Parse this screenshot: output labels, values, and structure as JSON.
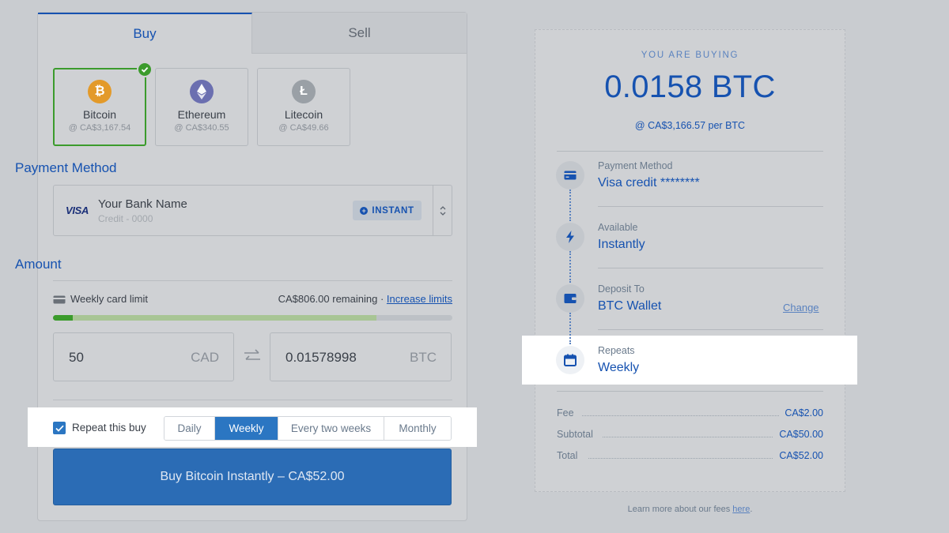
{
  "tabs": [
    {
      "label": "Buy",
      "active": true
    },
    {
      "label": "Sell",
      "active": false
    }
  ],
  "coins": [
    {
      "name": "Bitcoin",
      "price": "@ CA$3,167.54",
      "symbol": "₿",
      "color": "#e39a2a",
      "selected": true
    },
    {
      "name": "Ethereum",
      "price": "@ CA$340.55",
      "symbol": "ethereum-icon",
      "color": "#6b6fb0",
      "selected": false
    },
    {
      "name": "Litecoin",
      "price": "@ CA$49.66",
      "symbol": "Ł",
      "color": "#9aa0a6",
      "selected": false
    }
  ],
  "payment": {
    "title": "Payment Method",
    "card_brand": "VISA",
    "bank_name": "Your Bank Name",
    "bank_sub": "Credit - 0000",
    "badge": "INSTANT"
  },
  "amount": {
    "title": "Amount",
    "limit_label": "Weekly card limit",
    "remaining": "CA$806.00 remaining",
    "separator": "·",
    "increase_link": "Increase limits",
    "progress_used_fraction": 0.05,
    "progress_filled_fraction": 0.81,
    "fiat_value": "50",
    "fiat_unit": "CAD",
    "crypto_value": "0.01578998",
    "crypto_unit": "BTC"
  },
  "repeat": {
    "label": "Repeat this buy",
    "checked": true,
    "options": [
      "Daily",
      "Weekly",
      "Every two weeks",
      "Monthly"
    ],
    "selected": "Weekly"
  },
  "buy_button": "Buy Bitcoin Instantly – CA$52.00",
  "receipt": {
    "heading": "YOU ARE BUYING",
    "amount": "0.0158 BTC",
    "rate": "@ CA$3,166.57 per BTC",
    "steps": [
      {
        "label": "Payment Method",
        "value": "Visa credit ********",
        "icon": "card-icon"
      },
      {
        "label": "Available",
        "value": "Instantly",
        "icon": "lightning-icon"
      },
      {
        "label": "Deposit To",
        "value": "BTC Wallet",
        "icon": "wallet-icon",
        "action": "Change"
      },
      {
        "label": "Repeats",
        "value": "Weekly",
        "icon": "calendar-icon"
      }
    ],
    "fees": [
      {
        "label": "Fee",
        "value": "CA$2.00"
      },
      {
        "label": "Subtotal",
        "value": "CA$50.00"
      },
      {
        "label": "Total",
        "value": "CA$52.00"
      }
    ],
    "learn_more_prefix": "Learn more about our fees ",
    "learn_more_link": "here",
    "learn_more_suffix": "."
  },
  "colors": {
    "accent": "#1652b0",
    "button": "#2b6cb5",
    "success": "#3b9b2c"
  }
}
